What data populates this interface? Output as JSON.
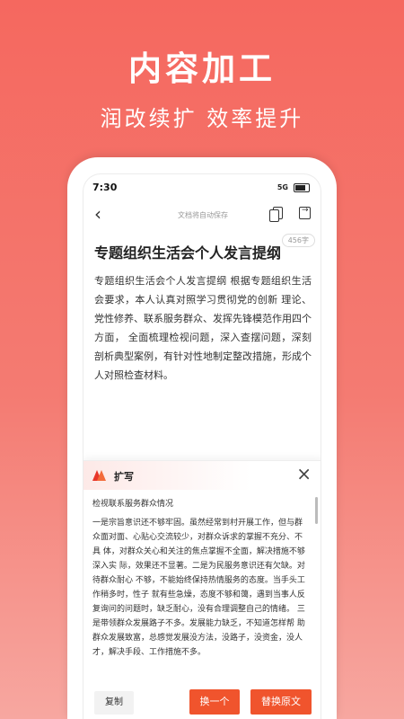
{
  "promo": {
    "headline": "内容加工",
    "subline": "润改续扩  效率提升"
  },
  "status_bar": {
    "time": "7:30",
    "signal": "5G"
  },
  "nav": {
    "back_icon": "‹",
    "autosave_text": "文档将自动保存"
  },
  "document": {
    "word_count": "456字",
    "title": "专题组织生活会个人发言提纲",
    "body": "专题组织生活会个人发言提纲 根据专题组织生活会要求，本人认真对照学习贯彻党的创新 理论、党性修养、联系服务群众、发挥先锋模范作用四个方面， 全面梳理检视问题，深入查摆问题，深刻剖析典型案例，有针对性地制定整改措施，形成个人对照检查材料。"
  },
  "ai_panel": {
    "title": "扩写",
    "close_icon": "×",
    "section_heading": "检视联系服务群众情况",
    "paragraph": "一是宗旨意识还不够牢固。虽然经常到村开展工作，但与群 众面对面、心贴心交流较少，对群众诉求的掌握不充分、不具 体，对群众关心和关注的焦点掌握不全面，解决措施不够深入实 际，效果还不显著。二是为民服务意识还有欠缺。对待群众耐心 不够，不能始终保持热情服务的态度。当手头工作稍多时，性子 就有些急燥，态度不够和蔼，遇到当事人反复询问的问题时，缺乏耐心，没有合理调整自己的情绪。 三是带领群众发展路子不多。发展能力缺乏，不知道怎样帮 助群众发展致富，总感觉发展没方法，没路子，没资金，没人 才，解决手段、工作措施不多。",
    "buttons": {
      "copy": "复制",
      "swap": "换一个",
      "replace": "替换原文"
    }
  },
  "colors": {
    "accent": "#f0542d",
    "background": "#f5685f"
  }
}
